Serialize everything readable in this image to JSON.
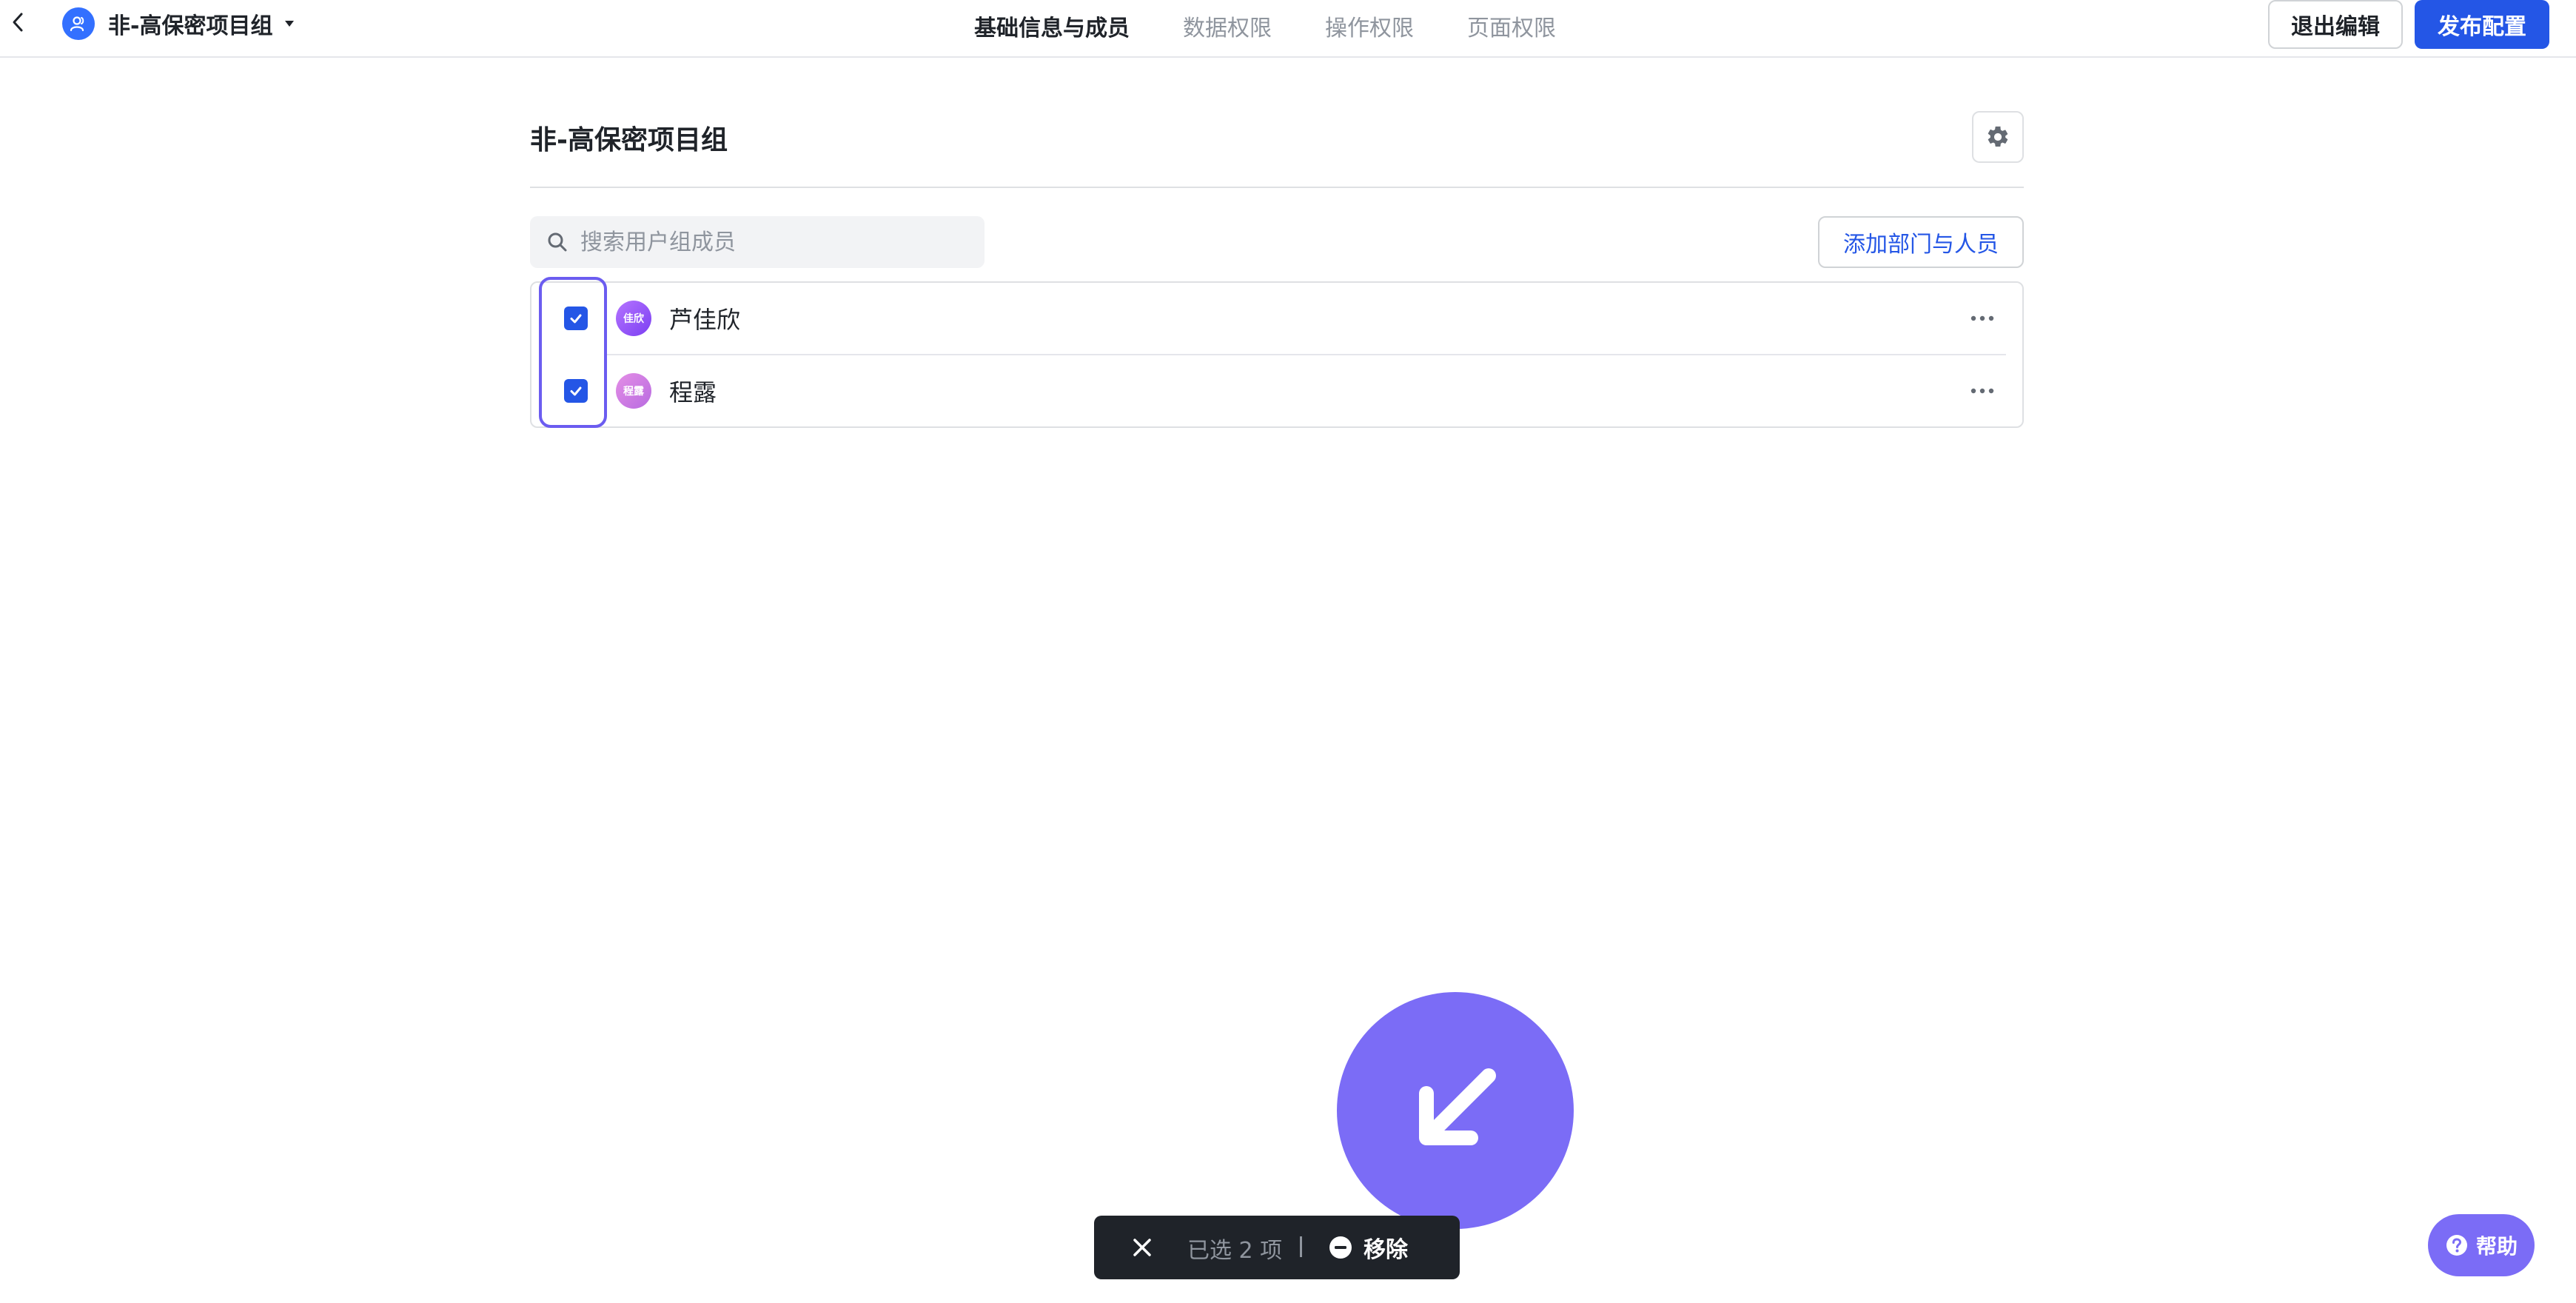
{
  "header": {
    "group_name": "非-高保密项目组",
    "tabs": [
      {
        "label": "基础信息与成员",
        "active": true
      },
      {
        "label": "数据权限",
        "active": false
      },
      {
        "label": "操作权限",
        "active": false
      },
      {
        "label": "页面权限",
        "active": false
      }
    ],
    "exit_label": "退出编辑",
    "publish_label": "发布配置"
  },
  "main": {
    "title": "非-高保密项目组",
    "search": {
      "placeholder": "搜索用户组成员",
      "value": ""
    },
    "add_label": "添加部门与人员",
    "members": [
      {
        "name": "芦佳欣",
        "avatar_text": "佳欣",
        "checked": true
      },
      {
        "name": "程露",
        "avatar_text": "程露",
        "checked": true
      }
    ]
  },
  "selection_bar": {
    "count_label": "已选 2 项",
    "remove_label": "移除"
  },
  "help": {
    "label": "帮助"
  },
  "colors": {
    "primary": "#2456e6",
    "accent": "#7b6cf6",
    "dark_bar": "#1f2329",
    "border": "#dee0e3"
  }
}
